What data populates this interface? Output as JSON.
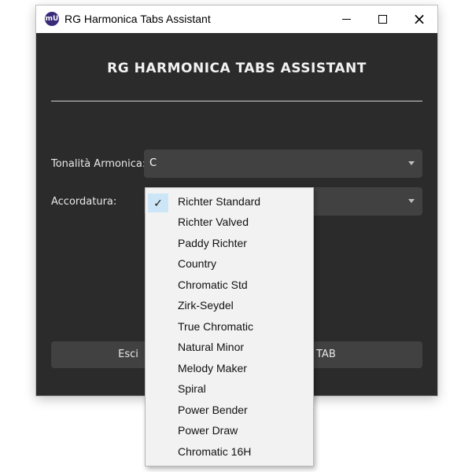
{
  "window": {
    "title": "RG Harmonica Tabs Assistant",
    "icon": "mu-logo-icon",
    "controls": {
      "minimize": "minimize-icon",
      "maximize": "maximize-icon",
      "close": "×"
    }
  },
  "main": {
    "heading": "RG HARMONICA TABS ASSISTANT",
    "key_label": "Tonalità Armonica:",
    "key_value": "C",
    "tuning_label": "Accordatura:",
    "exit_button": "Esci",
    "tab_button": "TAB"
  },
  "dropdown": {
    "check": "✓",
    "selected": "Richter Standard",
    "options": [
      "Richter Standard",
      "Richter Valved",
      "Paddy Richter",
      "Country",
      "Chromatic Std",
      "Zirk-Seydel",
      "True Chromatic",
      "Natural Minor",
      "Melody Maker",
      "Spiral",
      "Power Bender",
      "Power Draw",
      "Chromatic 16H"
    ]
  },
  "colors": {
    "window_bg": "#2b2b2b",
    "combo_bg": "#414141",
    "selection_bg": "#cde6f7"
  }
}
